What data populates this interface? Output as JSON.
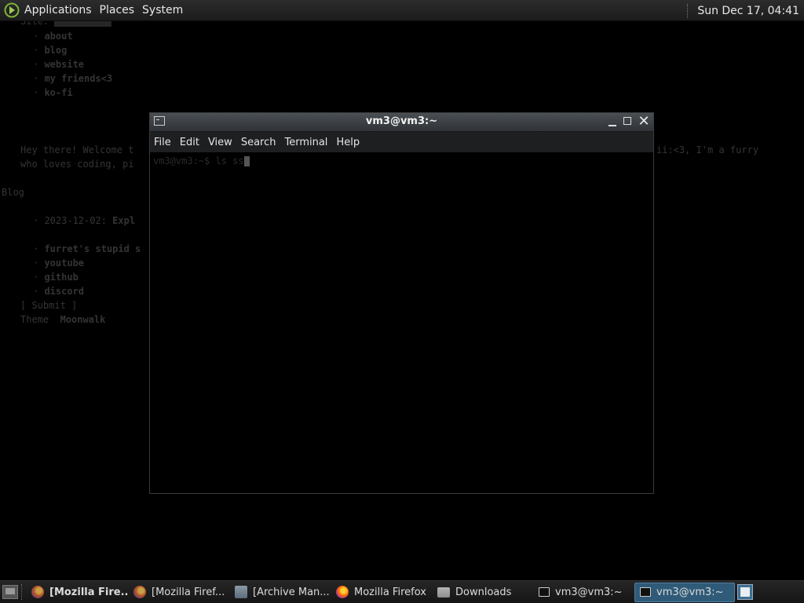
{
  "top_panel": {
    "menus": [
      "Applications",
      "Places",
      "System"
    ],
    "clock": "Sun Dec 17, 04:41"
  },
  "background_page": {
    "partial_line": "Site:",
    "nav_items": [
      "about",
      "blog",
      "website",
      "my friends<3",
      "ko-fi"
    ],
    "intro_line1_left": "Hey there! Welcome t",
    "intro_line1_right": "ii:<3, I'm a furry",
    "intro_line2": "who loves coding, pi",
    "blog_heading": "Blog",
    "blog_entry_date": "2023-12-02:",
    "blog_entry_title": "Expl",
    "links": [
      "furret's stupid s",
      "youtube",
      "github",
      "discord"
    ],
    "submit_label": "[ Submit ]",
    "theme_label": "Theme",
    "theme_value": "Moonwalk"
  },
  "terminal": {
    "title": "vm3@vm3:~",
    "menus": [
      "File",
      "Edit",
      "View",
      "Search",
      "Terminal",
      "Help"
    ],
    "prompt": "vm3@vm3:~$ ls ss"
  },
  "taskbar": {
    "tasks": [
      {
        "label": "[Mozilla Fire...",
        "icon": "firefox-icon",
        "bold": true
      },
      {
        "label": "[Mozilla Firef...",
        "icon": "firefox-icon",
        "bold": false
      },
      {
        "label": "[Archive Man...",
        "icon": "archive-manager-icon",
        "bold": false
      },
      {
        "label": "Mozilla Firefox",
        "icon": "firefox-icon",
        "bold": false
      },
      {
        "label": "Downloads",
        "icon": "folder-icon",
        "bold": false
      },
      {
        "label": "vm3@vm3:~",
        "icon": "terminal-icon",
        "bold": false
      },
      {
        "label": "vm3@vm3:~",
        "icon": "terminal-icon",
        "bold": false,
        "active": true
      }
    ]
  },
  "colors": {
    "panel_bg": "#1c1c1c",
    "active_task": "#2f5a78",
    "terminal_bg": "#000000",
    "titlebar": "#3b4045"
  }
}
